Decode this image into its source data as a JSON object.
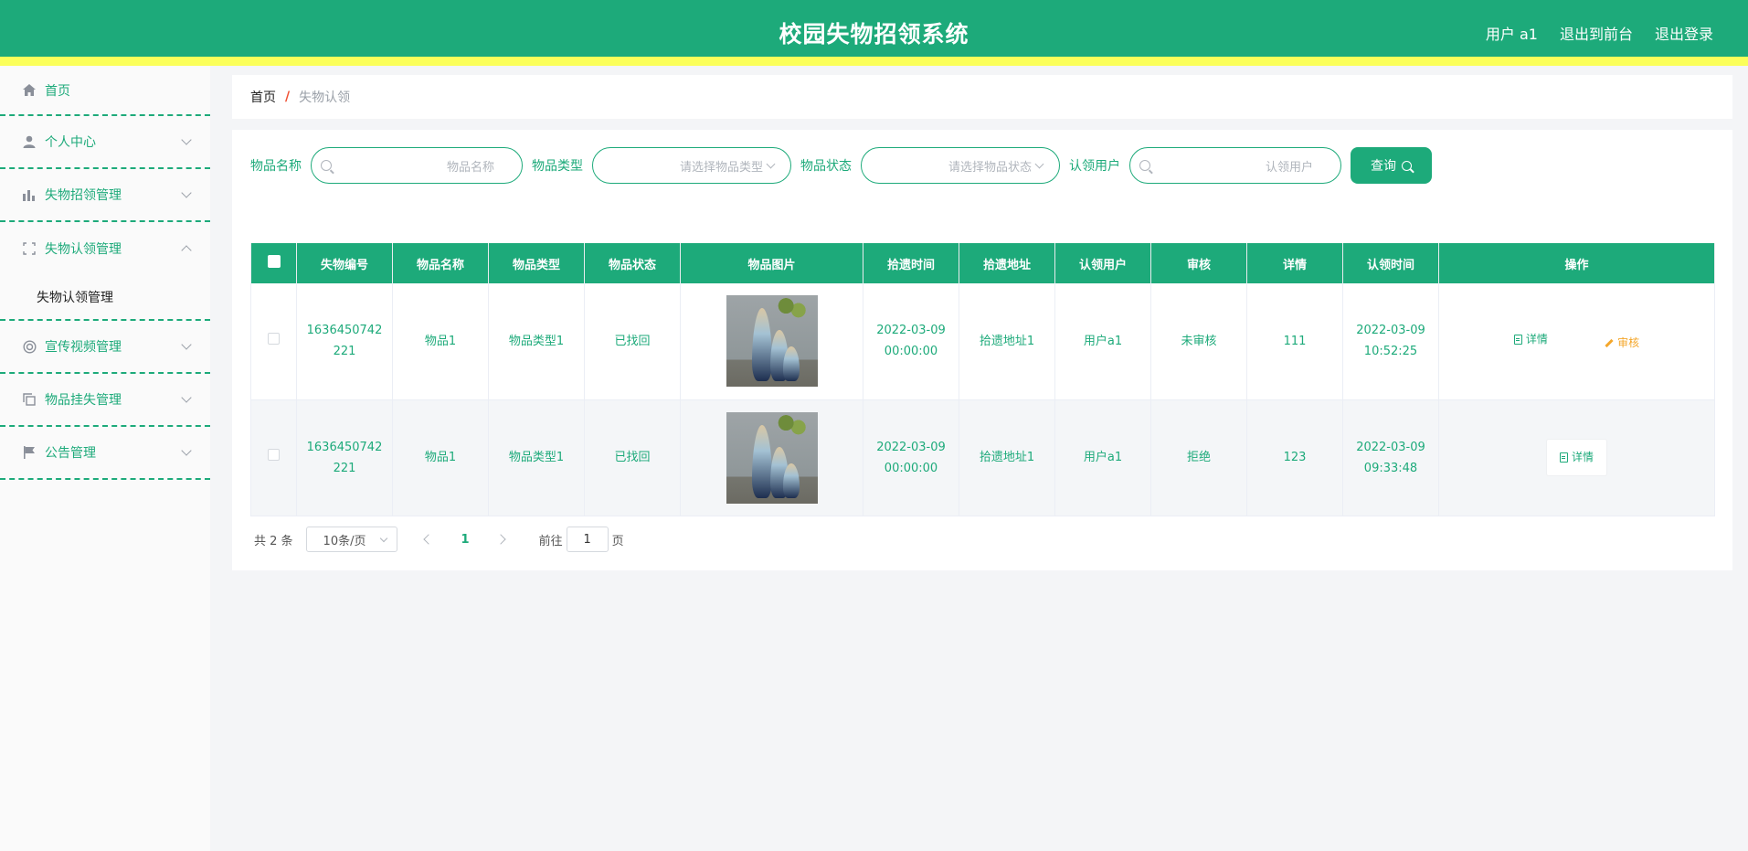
{
  "header": {
    "title": "校园失物招领系统",
    "user": "用户 a1",
    "to_front": "退出到前台",
    "logout": "退出登录"
  },
  "sidebar": {
    "items": [
      {
        "label": "首页",
        "icon": "home-icon"
      },
      {
        "label": "个人中心",
        "icon": "user-icon"
      },
      {
        "label": "失物招领管理",
        "icon": "chart-icon"
      },
      {
        "label": "失物认领管理",
        "icon": "scan-icon"
      },
      {
        "label": "宣传视频管理",
        "icon": "lifebuoy-icon"
      },
      {
        "label": "物品挂失管理",
        "icon": "copy-icon"
      },
      {
        "label": "公告管理",
        "icon": "flag-icon"
      }
    ],
    "submenu": "失物认领管理"
  },
  "breadcrumb": {
    "home": "首页",
    "sep": "/",
    "current": "失物认领"
  },
  "search": {
    "name_label": "物品名称",
    "name_placeholder": "物品名称",
    "type_label": "物品类型",
    "type_placeholder": "请选择物品类型",
    "status_label": "物品状态",
    "status_placeholder": "请选择物品状态",
    "user_label": "认领用户",
    "user_placeholder": "认领用户",
    "query_button": "查询"
  },
  "table": {
    "headers": [
      "失物编号",
      "物品名称",
      "物品类型",
      "物品状态",
      "物品图片",
      "拾遗时间",
      "拾遗地址",
      "认领用户",
      "审核",
      "详情",
      "认领时间",
      "操作"
    ],
    "rows": [
      {
        "id_a": "1636450742",
        "id_b": "221",
        "name": "物品1",
        "type": "物品类型1",
        "status": "已找回",
        "found_date": "2022-03-09",
        "found_time": "00:00:00",
        "address": "拾遗地址1",
        "user": "用户a1",
        "audit": "未审核",
        "detail": "111",
        "claim_date": "2022-03-09",
        "claim_time": "10:52:25",
        "act_detail": "详情",
        "act_audit": "审核"
      },
      {
        "id_a": "1636450742",
        "id_b": "221",
        "name": "物品1",
        "type": "物品类型1",
        "status": "已找回",
        "found_date": "2022-03-09",
        "found_time": "00:00:00",
        "address": "拾遗地址1",
        "user": "用户a1",
        "audit": "拒绝",
        "detail": "123",
        "claim_date": "2022-03-09",
        "claim_time": "09:33:48",
        "act_detail": "详情"
      }
    ]
  },
  "pager": {
    "total": "共 2 条",
    "page_size": "10条/页",
    "current": "1",
    "goto_prefix": "前往",
    "goto_value": "1",
    "goto_suffix": "页"
  },
  "colors": {
    "primary": "#1daa7a",
    "accent_bar": "#fbff5a",
    "warning": "#f4a72c",
    "breadcrumb_sep": "#f05033"
  }
}
